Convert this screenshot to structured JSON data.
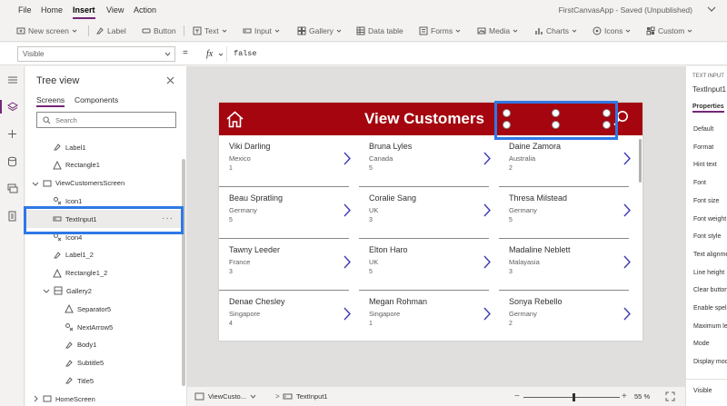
{
  "menu": {
    "items": [
      {
        "label": "File"
      },
      {
        "label": "Home"
      },
      {
        "label": "Insert",
        "active": true
      },
      {
        "label": "View"
      },
      {
        "label": "Action"
      }
    ],
    "app_title": "FirstCanvasApp - Saved (Unpublished)"
  },
  "ribbon": {
    "new_screen": "New screen",
    "label": "Label",
    "button": "Button",
    "text": "Text",
    "input": "Input",
    "gallery": "Gallery",
    "data_table": "Data table",
    "forms": "Forms",
    "media": "Media",
    "charts": "Charts",
    "icons": "Icons",
    "custom": "Custom"
  },
  "formula": {
    "property": "Visible",
    "equals": "=",
    "fx": "fx",
    "value": "false"
  },
  "tree": {
    "title": "Tree view",
    "tabs": [
      "Screens",
      "Components"
    ],
    "search_placeholder": "Search",
    "items": [
      {
        "label": "Label1",
        "icon": "label-icon",
        "depth": 1
      },
      {
        "label": "Rectangle1",
        "icon": "shape-icon",
        "depth": 1
      },
      {
        "label": "ViewCustomersScreen",
        "icon": "screen-icon",
        "depth": 0,
        "expander": "expanded"
      },
      {
        "label": "Icon1",
        "icon": "icon-control-icon",
        "depth": 1
      },
      {
        "label": "TextInput1",
        "icon": "text-input-icon",
        "depth": 1,
        "selected": true,
        "more": "···"
      },
      {
        "label": "Icon4",
        "icon": "icon-control-icon",
        "depth": 1
      },
      {
        "label": "Label1_2",
        "icon": "label-icon",
        "depth": 1
      },
      {
        "label": "Rectangle1_2",
        "icon": "shape-icon",
        "depth": 1
      },
      {
        "label": "Gallery2",
        "icon": "gallery-icon",
        "depth": 1,
        "expander": "expanded"
      },
      {
        "label": "Separator5",
        "icon": "shape-icon",
        "depth": 2
      },
      {
        "label": "NextArrow5",
        "icon": "icon-control-icon",
        "depth": 2
      },
      {
        "label": "Body1",
        "icon": "label-icon",
        "depth": 2
      },
      {
        "label": "Subtitle5",
        "icon": "label-icon",
        "depth": 2
      },
      {
        "label": "Title5",
        "icon": "label-icon",
        "depth": 2
      },
      {
        "label": "HomeScreen",
        "icon": "screen-icon",
        "depth": 0,
        "expander": "collapsed"
      }
    ]
  },
  "screen": {
    "title": "View Customers",
    "header_color": "#a4050e",
    "arrow_color": "#3b3ab8",
    "customers": [
      {
        "name": "Viki  Darling",
        "country": "Mexico",
        "number": "1"
      },
      {
        "name": "Bruna  Lyles",
        "country": "Canada",
        "number": "5"
      },
      {
        "name": "Daine  Zamora",
        "country": "Australia",
        "number": "2"
      },
      {
        "name": "Beau  Spratling",
        "country": "Germany",
        "number": "5"
      },
      {
        "name": "Coralie  Sang",
        "country": "UK",
        "number": "3"
      },
      {
        "name": "Thresa  Milstead",
        "country": "Germany",
        "number": "5"
      },
      {
        "name": "Tawny  Leeder",
        "country": "France",
        "number": "3"
      },
      {
        "name": "Elton  Haro",
        "country": "UK",
        "number": "5"
      },
      {
        "name": "Madaline  Neblett",
        "country": "Malayasia",
        "number": "3"
      },
      {
        "name": "Denae  Chesley",
        "country": "Singapore",
        "number": "4"
      },
      {
        "name": "Megan  Rohman",
        "country": "Singapore",
        "number": "1"
      },
      {
        "name": "Sonya  Rebello",
        "country": "Germany",
        "number": "2"
      }
    ]
  },
  "properties": {
    "kind": "TEXT INPUT",
    "name": "TextInput1",
    "tab": "Properties",
    "items": [
      "Default",
      "Format",
      "Hint text",
      "Font",
      "Font size",
      "Font weight",
      "Font style",
      "Text alignment",
      "Line height",
      "Clear button",
      "Enable spell check",
      "Maximum length",
      "Mode",
      "Display mode",
      "Visible"
    ]
  },
  "status": {
    "screen": "ViewCusto...",
    "separator": ">",
    "control": "TextInput1",
    "zoom_minus": "−",
    "zoom_plus": "+",
    "zoom": "55",
    "zoom_fraction": 0.55,
    "zoom_unit": "%"
  },
  "highlight_color": "#2f78e6",
  "accent": "#742774"
}
